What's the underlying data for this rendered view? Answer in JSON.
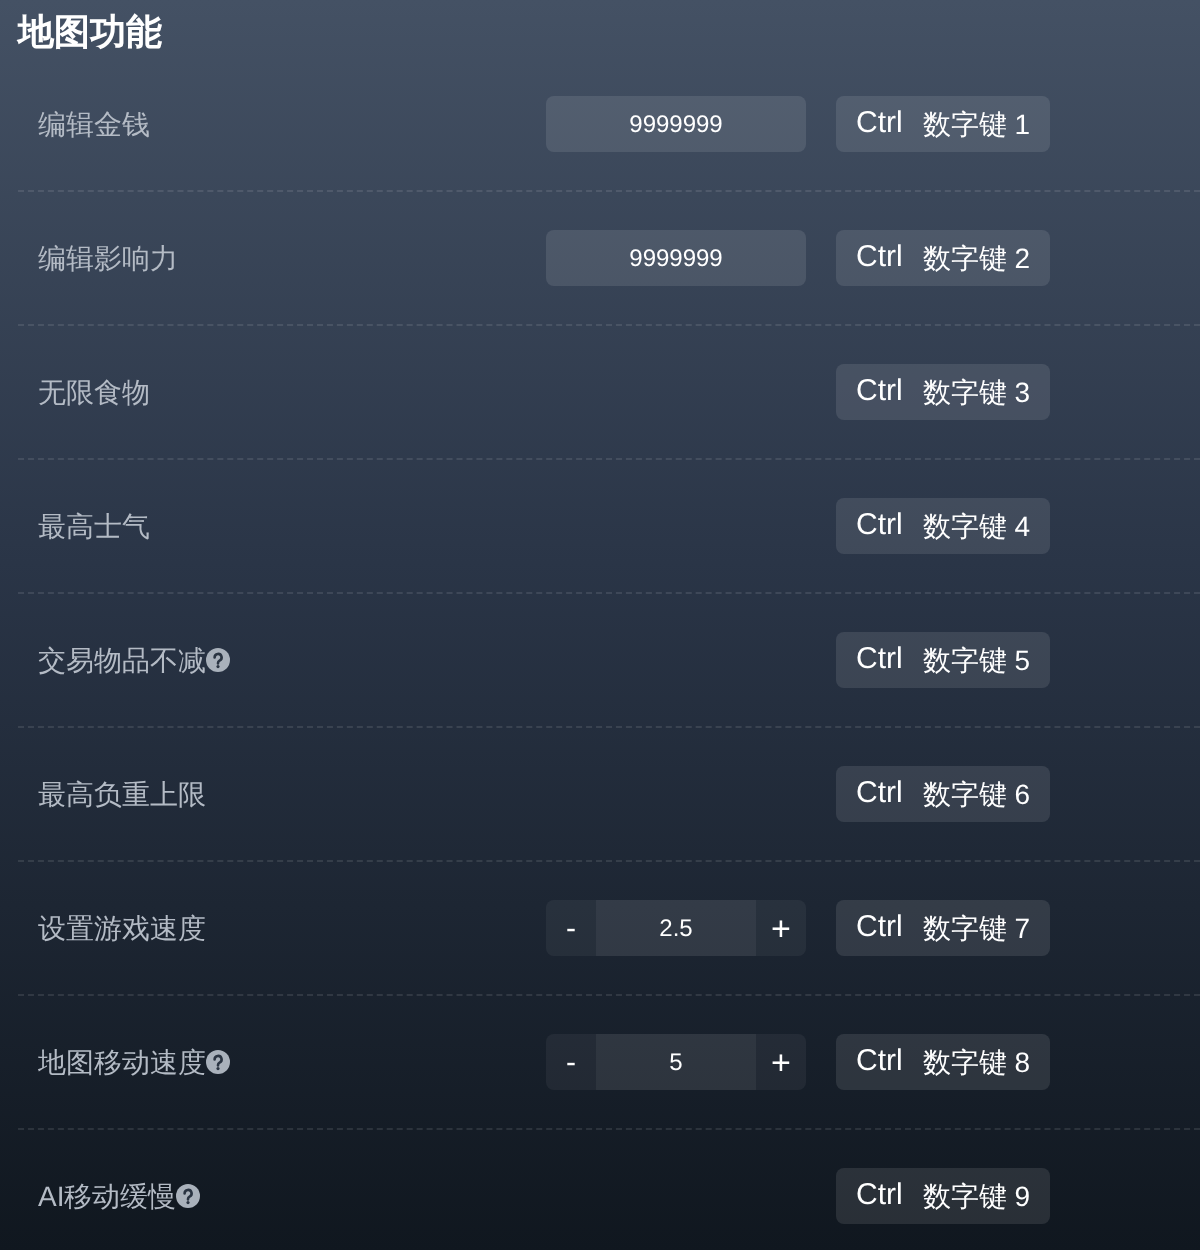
{
  "title": "地图功能",
  "rows": [
    {
      "label": "编辑金钱",
      "help": false,
      "kind": "input",
      "value": "9999999",
      "hotkey": {
        "modifier": "Ctrl",
        "key": "数字键 1"
      }
    },
    {
      "label": "编辑影响力",
      "help": false,
      "kind": "input",
      "value": "9999999",
      "hotkey": {
        "modifier": "Ctrl",
        "key": "数字键 2"
      }
    },
    {
      "label": "无限食物",
      "help": false,
      "kind": "plain",
      "hotkey": {
        "modifier": "Ctrl",
        "key": "数字键 3"
      }
    },
    {
      "label": "最高士气",
      "help": false,
      "kind": "plain",
      "hotkey": {
        "modifier": "Ctrl",
        "key": "数字键 4"
      }
    },
    {
      "label": "交易物品不减",
      "help": true,
      "kind": "plain",
      "hotkey": {
        "modifier": "Ctrl",
        "key": "数字键 5"
      }
    },
    {
      "label": "最高负重上限",
      "help": false,
      "kind": "plain",
      "hotkey": {
        "modifier": "Ctrl",
        "key": "数字键 6"
      }
    },
    {
      "label": "设置游戏速度",
      "help": false,
      "kind": "stepper",
      "decrement": "-",
      "value": "2.5",
      "increment": "+",
      "hotkey": {
        "modifier": "Ctrl",
        "key": "数字键 7"
      }
    },
    {
      "label": "地图移动速度",
      "help": true,
      "kind": "stepper",
      "decrement": "-",
      "value": "5",
      "increment": "+",
      "hotkey": {
        "modifier": "Ctrl",
        "key": "数字键 8"
      }
    },
    {
      "label": "AI移动缓慢",
      "help": true,
      "kind": "plain",
      "hotkey": {
        "modifier": "Ctrl",
        "key": "数字键 9"
      }
    }
  ]
}
